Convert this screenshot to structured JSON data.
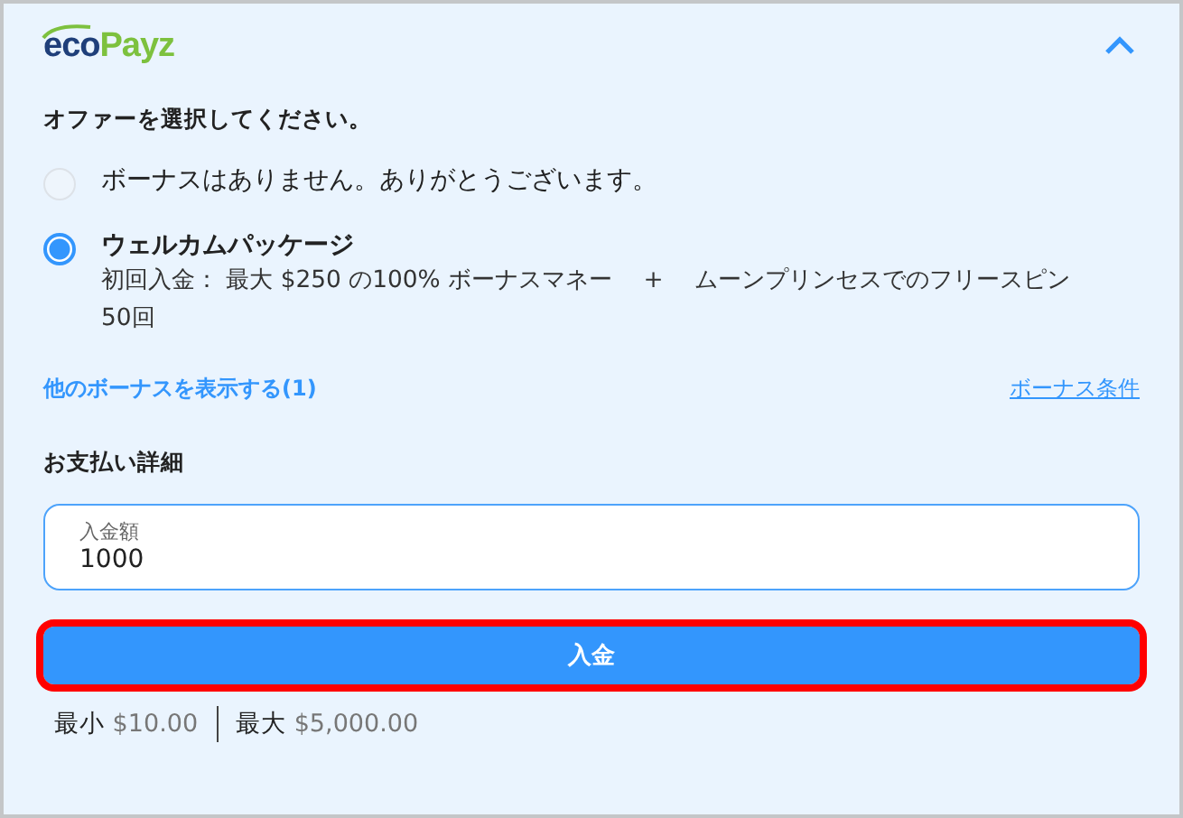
{
  "logo": {
    "part_1": "eco",
    "part_2": "Payz"
  },
  "panel": {
    "expanded": true
  },
  "offer_prompt": "オファーを選択してください。",
  "offers": [
    {
      "title": "ボーナスはありません。ありがとうございます。",
      "selected": false
    },
    {
      "title": "ウェルカムパッケージ",
      "description": "初回入金： 最大 $250 の100% ボーナスマネー　 +　 ムーンプリンセスでのフリースピン50回",
      "selected": true
    }
  ],
  "more_bonuses_link": "他のボーナスを表示する(1)",
  "bonus_terms_link": "ボーナス条件",
  "payment_heading": "お支払い詳細",
  "amount_field": {
    "label": "入金額",
    "value": "1000"
  },
  "deposit_button": {
    "label": "入金",
    "highlighted": true
  },
  "limits": [
    {
      "label": "最小",
      "value": "$10.00"
    },
    {
      "label": "最大",
      "value": "$5,000.00"
    }
  ]
}
